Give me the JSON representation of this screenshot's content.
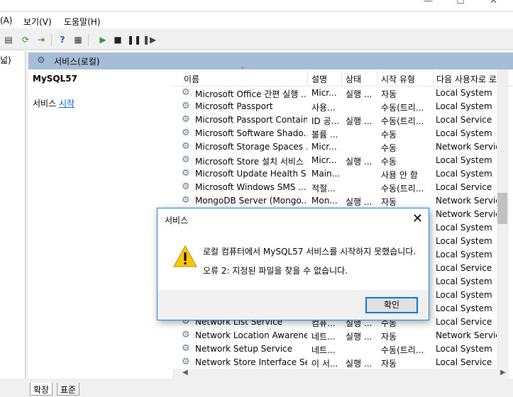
{
  "menu": [
    "(A)",
    "보기(V)",
    "도움말(H)"
  ],
  "tree": {
    "label": "넓)"
  },
  "panel_header": {
    "title": "서비스(로컬)"
  },
  "details": {
    "service_name": "MySQL57",
    "action_prefix": "서비스",
    "action_link": "시작"
  },
  "columns": {
    "name": "이름",
    "description": "설명",
    "status": "상태",
    "startup": "시작 유형",
    "logon": "다음 사용자로 로"
  },
  "rows": [
    {
      "name": "Microsoft Office 간편 실행 ...",
      "desc": "Micr...",
      "status": "실행 ...",
      "startup": "자동",
      "logon": "Local System"
    },
    {
      "name": "Microsoft Passport",
      "desc": "사용...",
      "status": "",
      "startup": "수동(트리...",
      "logon": "Local System"
    },
    {
      "name": "Microsoft Passport Container",
      "desc": "ID 공...",
      "status": "실행 ...",
      "startup": "수동(트리...",
      "logon": "Local Service"
    },
    {
      "name": "Microsoft Software Shado...",
      "desc": "볼륨 ...",
      "status": "",
      "startup": "수동",
      "logon": "Local System"
    },
    {
      "name": "Microsoft Storage Spaces ...",
      "desc": "Micr...",
      "status": "",
      "startup": "수동",
      "logon": "Network Service"
    },
    {
      "name": "Microsoft Store 설치 서비스",
      "desc": "Micr...",
      "status": "실행 ...",
      "startup": "수동",
      "logon": "Local System"
    },
    {
      "name": "Microsoft Update Health S...",
      "desc": "Main...",
      "status": "",
      "startup": "사용 안 함",
      "logon": "Local System"
    },
    {
      "name": "Microsoft Windows SMS ...",
      "desc": "적절...",
      "status": "",
      "startup": "수동(트리...",
      "logon": "Local Service"
    },
    {
      "name": "MongoDB Server (Mongo...",
      "desc": "Mon...",
      "status": "실행 ...",
      "startup": "자동",
      "logon": "Network Service"
    },
    {
      "name": "",
      "desc": "",
      "status": "",
      "startup": "",
      "logon": "Network Service"
    },
    {
      "name": "",
      "desc": "",
      "status": "",
      "startup": "",
      "logon": "Local System"
    },
    {
      "name": "",
      "desc": "",
      "status": "",
      "startup": "",
      "logon": "Local System"
    },
    {
      "name": "",
      "desc": "",
      "status": "",
      "startup": "",
      "logon": "Local System"
    },
    {
      "name": "",
      "desc": "",
      "status": "",
      "startup": "",
      "logon": "Local Service"
    },
    {
      "name": "",
      "desc": "",
      "status": "",
      "startup": "",
      "logon": "Local System"
    },
    {
      "name": "",
      "desc": "",
      "status": "",
      "startup": "",
      "logon": "Local System"
    },
    {
      "name": "",
      "desc": "",
      "status": "",
      "startup": "",
      "logon": "Local System"
    },
    {
      "name": "Network List Service",
      "desc": "컴퓨...",
      "status": "실행 ...",
      "startup": "수동",
      "logon": "Local Service"
    },
    {
      "name": "Network Location Awareness",
      "desc": "네트...",
      "status": "실행 ...",
      "startup": "자동",
      "logon": "Network Service"
    },
    {
      "name": "Network Setup Service",
      "desc": "네트...",
      "status": "",
      "startup": "수동(트리...",
      "logon": "Local System"
    },
    {
      "name": "Network Store Interface Se...",
      "desc": "이 서...",
      "status": "실행 ...",
      "startup": "자동",
      "logon": "Local Service"
    }
  ],
  "tabs": {
    "extended": "확장",
    "standard": "표준"
  },
  "dialog": {
    "title": "서비스",
    "message": "로컬 컴퓨터에서 MySQL57 서비스를 시작하지 못했습니다.",
    "error": "오류 2: 지정된 파일을 찾을 수 없습니다.",
    "ok_label": "확인"
  }
}
